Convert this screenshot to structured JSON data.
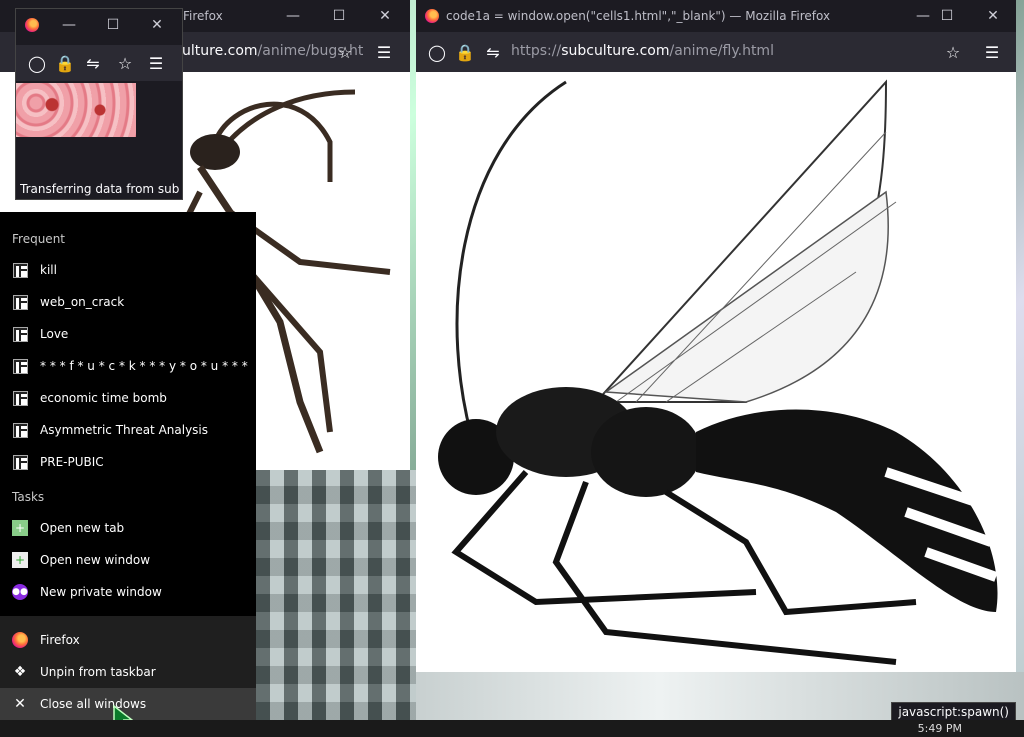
{
  "window_back": {
    "title": "Firefox",
    "url_host": "ulture.com",
    "url_path": "/anime/bugs.ht"
  },
  "window_small": {
    "status": "Transferring data from subcult"
  },
  "window_main": {
    "title": "code1a = window.open(\"cells1.html\",\"_blank\") — Mozilla Firefox",
    "url_scheme": "https://",
    "url_host": "subculture.com",
    "url_path": "/anime/fly.html"
  },
  "jumplist": {
    "frequent_label": "Frequent",
    "frequent": [
      "kill",
      "web_on_crack",
      "Love",
      "* * * f * u * c * k * * * y * o * u * * *",
      "economic time bomb",
      "Asymmetric Threat Analysis",
      "PRE-PUBIC"
    ],
    "tasks_label": "Tasks",
    "tasks": [
      "Open new tab",
      "Open new window",
      "New private window"
    ],
    "app": "Firefox",
    "unpin": "Unpin from taskbar",
    "close_all": "Close all windows"
  },
  "status_tip": "javascript:spawn()",
  "clock": "5:49 PM",
  "colors": {
    "frame": "#1c1b22",
    "toolbar": "#2b2a33",
    "jumplist": "#000000"
  }
}
